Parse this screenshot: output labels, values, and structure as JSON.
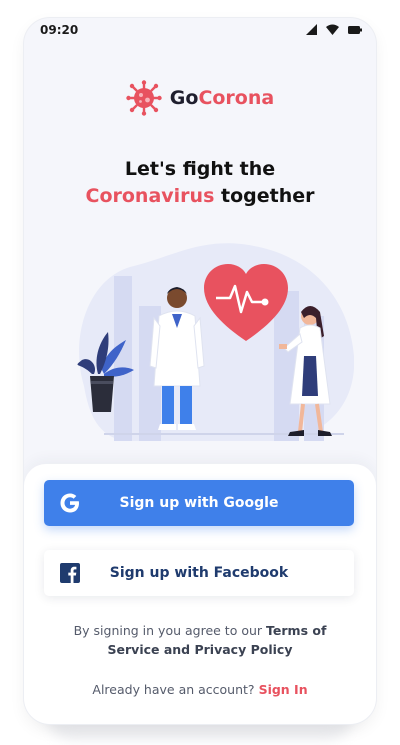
{
  "status_bar": {
    "time": "09:20"
  },
  "brand": {
    "prefix": "Go",
    "accent": "Corona"
  },
  "headline": {
    "line1": "Let's fight the",
    "accent": "Coronavirus",
    "rest": "together"
  },
  "auth": {
    "google_label": "Sign up with Google",
    "facebook_label": "Sign up with Facebook",
    "terms_prefix": "By signing in you agree to our",
    "terms_link": "Terms of Service and Privacy Policy",
    "signin_prompt": "Already have an account?",
    "signin_link": "Sign In"
  },
  "colors": {
    "accent": "#e8525f",
    "google_blue": "#3f80ea",
    "facebook_navy": "#1f3b6e",
    "background": "#f5f6fb"
  },
  "icons": [
    "signal-icon",
    "wifi-icon",
    "battery-icon",
    "virus-logo-icon",
    "google-icon",
    "facebook-icon"
  ]
}
